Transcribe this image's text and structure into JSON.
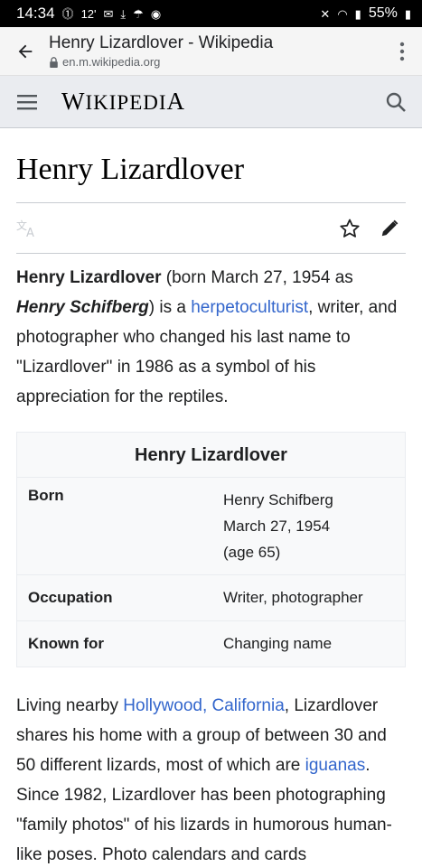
{
  "status_bar": {
    "time": "14:34",
    "notif_icons": [
      "alarm-icon",
      "12°",
      "mail-icon",
      "download-icon",
      "weather-icon",
      "camera-icon"
    ],
    "notif_badge": "12'",
    "battery": "55%"
  },
  "browser": {
    "tab_title": "Henry Lizardlover - Wikipedia",
    "url": "en.m.wikipedia.org"
  },
  "wiki": {
    "logo_first": "W",
    "logo_mid": "IKIPEDI",
    "logo_last": "A"
  },
  "article": {
    "title": "Henry Lizardlover",
    "lead": {
      "bold_name": "Henry Lizardlover",
      "t1": " (born March 27, 1954 as ",
      "birth_name": "Henry Schifberg",
      "t2": ") is a ",
      "link1": "herpetoculturist",
      "t3": ", writer, and photographer who changed his last name to \"Lizardlover\" in 1986 as a symbol of his appreciation for the reptiles."
    },
    "infobox": {
      "title": "Henry Lizardlover",
      "rows": [
        {
          "label": "Born",
          "line1": "Henry Schifberg",
          "line2": "March 27, 1954",
          "line3": "(age 65)"
        },
        {
          "label": "Occupation",
          "value": "Writer, photographer"
        },
        {
          "label": "Known for",
          "value": "Changing name"
        }
      ]
    },
    "body": {
      "t1": "Living nearby ",
      "link1": "Hollywood, California",
      "t2": ", Lizardlover shares his home with a group of between 30 and 50 different lizards, most of which are ",
      "link2": "iguanas",
      "t3": ". Since 1982, Lizardlover has been photographing \"family photos\" of his lizards in humorous human-like poses. Photo calendars and cards"
    }
  }
}
